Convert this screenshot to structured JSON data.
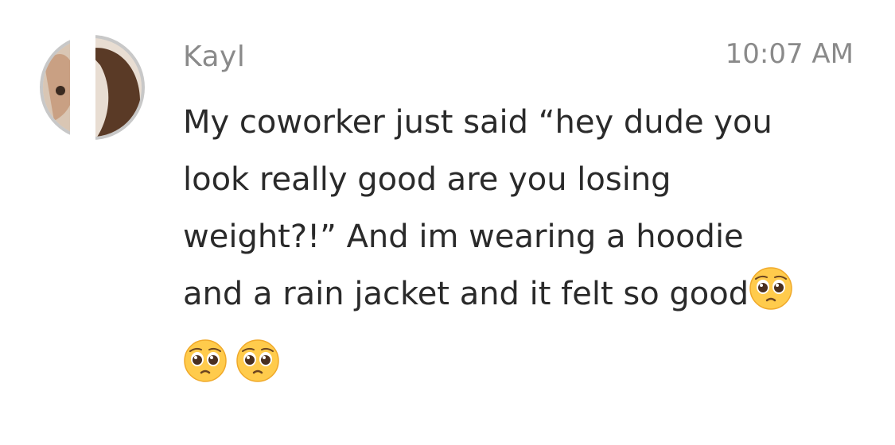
{
  "message": {
    "sender_name": "Kayl",
    "timestamp": "10:07 AM",
    "lines": [
      "My coworker just said “hey dude you",
      "look really good are you losing",
      "weight?!” And im wearing a hoodie",
      "and a rain jacket and it felt so good"
    ],
    "trailing_emojis": [
      "pleading-face",
      "pleading-face",
      "pleading-face"
    ]
  },
  "colors": {
    "meta_text": "#8a8a8a",
    "body_text": "#2a2a2a",
    "avatar_ring": "#c8c8c8"
  }
}
